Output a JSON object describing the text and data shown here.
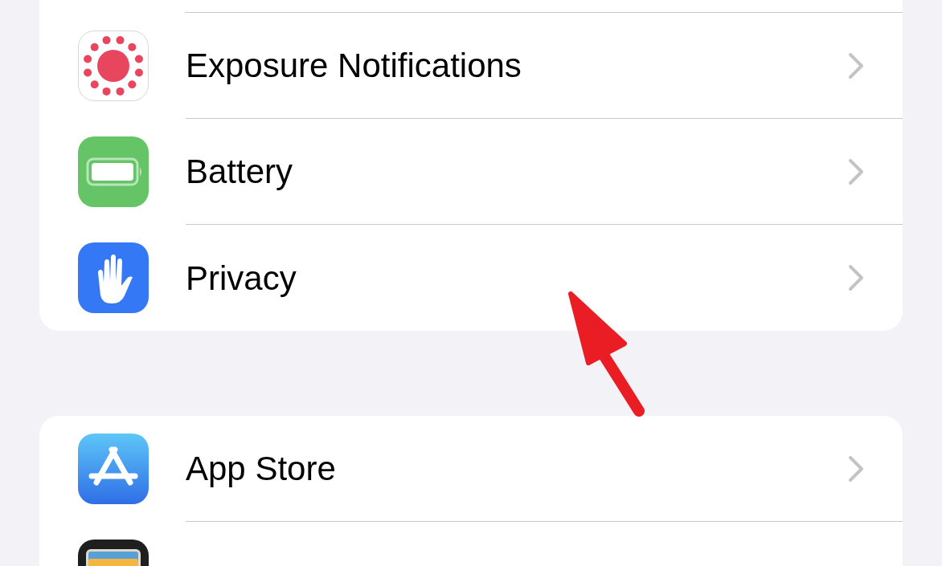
{
  "groups": [
    {
      "rows": [
        {
          "kind": "exposure",
          "label": "Exposure Notifications"
        },
        {
          "kind": "battery",
          "label": "Battery"
        },
        {
          "kind": "privacy",
          "label": "Privacy"
        }
      ]
    },
    {
      "rows": [
        {
          "kind": "appstore",
          "label": "App Store"
        },
        {
          "kind": "wallet"
        }
      ]
    }
  ]
}
